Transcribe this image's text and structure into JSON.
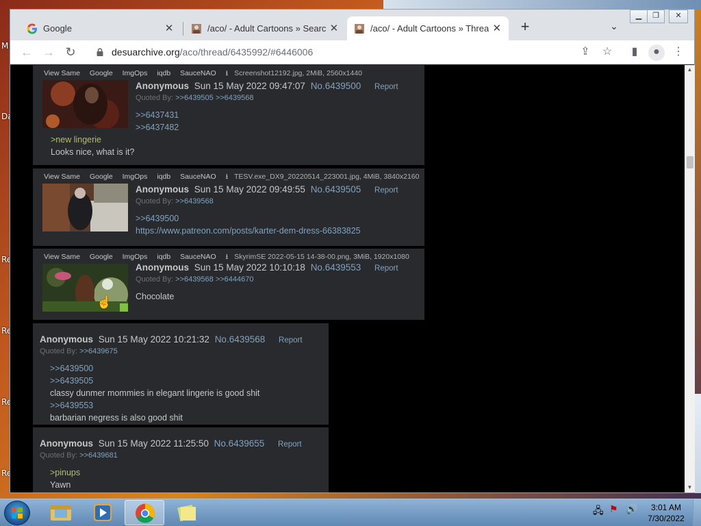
{
  "desktop": {
    "labels": [
      "M",
      "Da",
      "Re",
      "Re",
      "Re",
      "Re"
    ]
  },
  "browser": {
    "tabs": [
      {
        "title": "Google",
        "favicon": "google-g-icon",
        "active": false
      },
      {
        "title": "/aco/ - Adult Cartoons » Searching",
        "favicon": "archive-favicon",
        "active": false
      },
      {
        "title": "/aco/ - Adult Cartoons » Thread #",
        "favicon": "archive-favicon",
        "active": true
      }
    ],
    "new_tab_label": "+",
    "url_host": "desuarchive.org",
    "url_path": "/aco/thread/6435992/#6446006"
  },
  "image_links": [
    "View Same",
    "Google",
    "ImgOps",
    "iqdb",
    "SauceNAO"
  ],
  "posts": [
    {
      "has_image": true,
      "file": "Screenshot12192.jpg, 2MiB, 2560x1440",
      "name": "Anonymous",
      "date": "Sun 15 May 2022 09:47:07",
      "num": "No.6439500",
      "report": "Report",
      "quoted_label": "Quoted By:",
      "quoted_by": ">>6439505 >>6439568",
      "lines": [
        {
          "type": "link",
          "text": ">>6437431"
        },
        {
          "type": "link",
          "text": ">>6437482"
        },
        {
          "type": "greentext",
          "text": ">new lingerie"
        },
        {
          "type": "text",
          "text": "Looks nice, what is it?"
        }
      ]
    },
    {
      "has_image": true,
      "file": "TESV.exe_DX9_20220514_223001.jpg, 4MiB, 3840x2160",
      "name": "Anonymous",
      "date": "Sun 15 May 2022 09:49:55",
      "num": "No.6439505",
      "report": "Report",
      "quoted_label": "Quoted By:",
      "quoted_by": ">>6439568",
      "lines": [
        {
          "type": "link",
          "text": ">>6439500"
        },
        {
          "type": "url",
          "text": "https://www.patreon.com/posts/karter-dem-dress-66383825"
        }
      ]
    },
    {
      "has_image": true,
      "file": "SkyrimSE 2022-05-15 14-38-00.png, 3MiB, 1920x1080",
      "name": "Anonymous",
      "date": "Sun 15 May 2022 10:10:18",
      "num": "No.6439553",
      "report": "Report",
      "quoted_label": "Quoted By:",
      "quoted_by": ">>6439568 >>6444670",
      "lines": [
        {
          "type": "text",
          "text": "Chocolate"
        }
      ]
    },
    {
      "has_image": false,
      "name": "Anonymous",
      "date": "Sun 15 May 2022 10:21:32",
      "num": "No.6439568",
      "report": "Report",
      "quoted_label": "Quoted By:",
      "quoted_by": ">>6439675",
      "lines": [
        {
          "type": "link",
          "text": ">>6439500"
        },
        {
          "type": "link",
          "text": ">>6439505"
        },
        {
          "type": "text",
          "text": "classy dunmer mommies in elegant lingerie is good shit"
        },
        {
          "type": "link",
          "text": ">>6439553"
        },
        {
          "type": "text",
          "text": "barbarian negress is also good shit"
        }
      ]
    },
    {
      "has_image": false,
      "name": "Anonymous",
      "date": "Sun 15 May 2022 11:25:50",
      "num": "No.6439655",
      "report": "Report",
      "quoted_label": "Quoted By:",
      "quoted_by": ">>6439681",
      "lines": [
        {
          "type": "greentext",
          "text": ">pinups"
        },
        {
          "type": "text",
          "text": "Yawn"
        }
      ]
    }
  ],
  "taskbar": {
    "apps": [
      "windows-explorer-icon",
      "media-player-icon",
      "chrome-icon",
      "sticky-notes-icon"
    ],
    "active_app": "chrome-icon",
    "time": "3:01 AM",
    "date": "7/30/2022"
  },
  "colors": {
    "page_bg": "#000000",
    "post_bg": "#282a2e",
    "link": "#81a2be",
    "greentext": "#b5bd68",
    "text": "#c5c8c6"
  }
}
